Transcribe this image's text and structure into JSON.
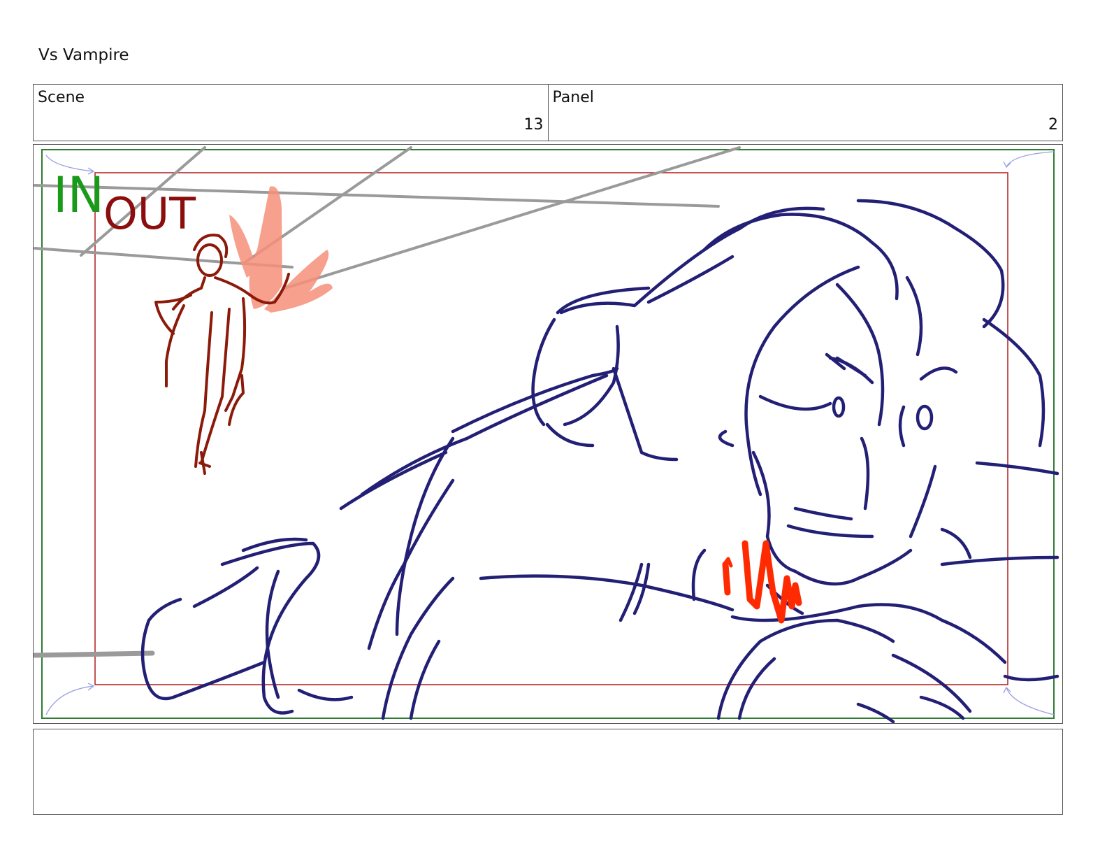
{
  "header": {
    "title": "Vs Vampire"
  },
  "meta": {
    "scene_label": "Scene",
    "scene_value": "13",
    "panel_label": "Panel",
    "panel_value": "2"
  },
  "frame": {
    "in_label": "IN",
    "out_label": "OUT"
  },
  "colors": {
    "in_frame": "#2e7d32",
    "out_frame": "#b01c1c",
    "sketch": "#221f75",
    "figure": "#8b1a0a",
    "accent": "#ff2a00",
    "flame": "#f5907a",
    "guide": "#9a9a9a"
  },
  "notes": {
    "text": ""
  }
}
